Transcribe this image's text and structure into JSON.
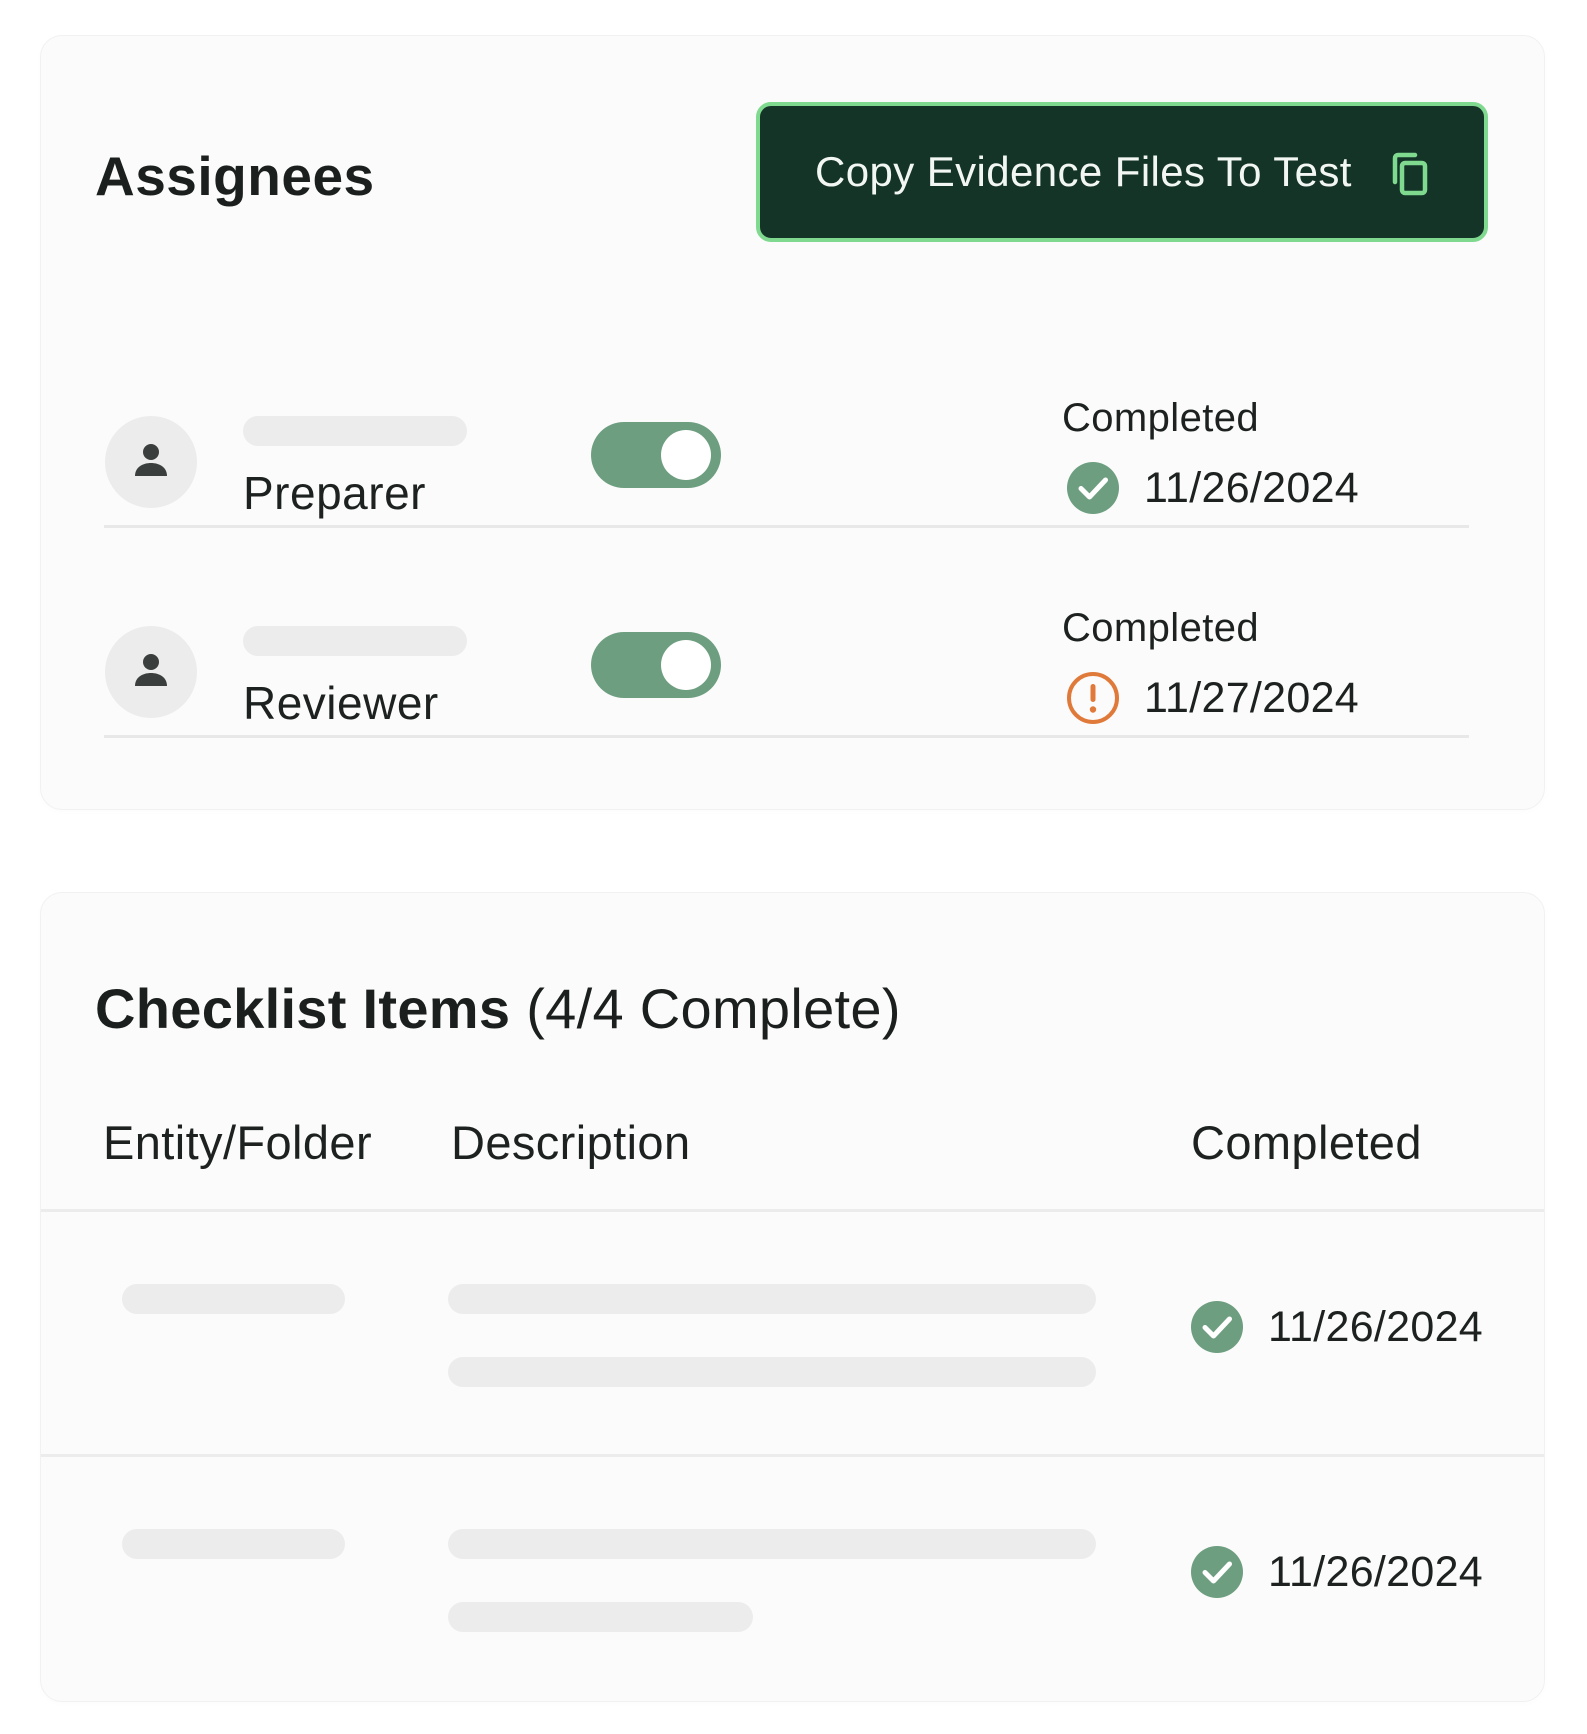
{
  "assignees": {
    "title": "Assignees",
    "copy_button": {
      "label": "Copy Evidence Files To Test",
      "icon": "copy-icon"
    },
    "rows": [
      {
        "role": "Preparer",
        "toggle_on": true,
        "status_label": "Completed",
        "status_icon": "check-circle-icon",
        "date": "11/26/2024"
      },
      {
        "role": "Reviewer",
        "toggle_on": true,
        "status_label": "Completed",
        "status_icon": "alert-circle-icon",
        "date": "11/27/2024"
      }
    ]
  },
  "checklist": {
    "title": "Checklist Items",
    "count": "(4/4 Complete)",
    "columns": [
      "Entity/Folder",
      "Description",
      "Completed"
    ],
    "rows": [
      {
        "status_icon": "check-circle-icon",
        "date": "11/26/2024"
      },
      {
        "status_icon": "check-circle-icon",
        "date": "11/26/2024"
      }
    ]
  },
  "colors": {
    "button_bg": "#143428",
    "button_border": "#7fd98e",
    "toggle_on": "#6d9e7f",
    "success": "#6d9e7f",
    "warning": "#e07a3a",
    "skeleton": "#ececec"
  }
}
